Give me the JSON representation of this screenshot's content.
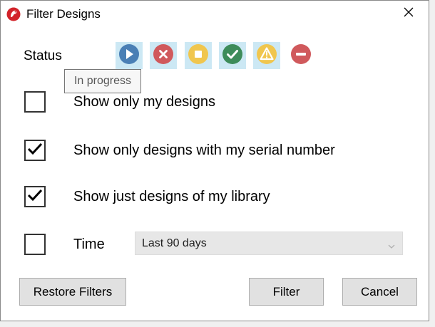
{
  "window": {
    "title": "Filter Designs",
    "app_icon": "app-logo-icon",
    "close_icon": "close-icon"
  },
  "status": {
    "label": "Status",
    "tooltip": "In progress",
    "buttons": [
      {
        "name": "in-progress",
        "icon": "play-icon",
        "color": "#4a7fb5",
        "selected": true
      },
      {
        "name": "cancelled",
        "icon": "x-circle-icon",
        "color": "#d0595c",
        "selected": true
      },
      {
        "name": "paused",
        "icon": "stop-square-icon",
        "color": "#f0c64e",
        "selected": true
      },
      {
        "name": "completed",
        "icon": "check-circle-icon",
        "color": "#3d8c5a",
        "selected": true
      },
      {
        "name": "warning",
        "icon": "warning-triangle-icon",
        "color": "#f0c64e",
        "selected": true
      },
      {
        "name": "blocked",
        "icon": "minus-circle-icon",
        "color": "#d0595c",
        "selected": false
      }
    ]
  },
  "options": {
    "my_designs": {
      "label": "Show only my designs",
      "checked": false
    },
    "serial_number": {
      "label": "Show only designs with my serial number",
      "checked": true
    },
    "library": {
      "label": "Show just designs of my library",
      "checked": true
    },
    "time": {
      "label": "Time",
      "checked": false,
      "selected_value": "Last 90 days"
    }
  },
  "buttons": {
    "restore": "Restore Filters",
    "filter": "Filter",
    "cancel": "Cancel"
  }
}
